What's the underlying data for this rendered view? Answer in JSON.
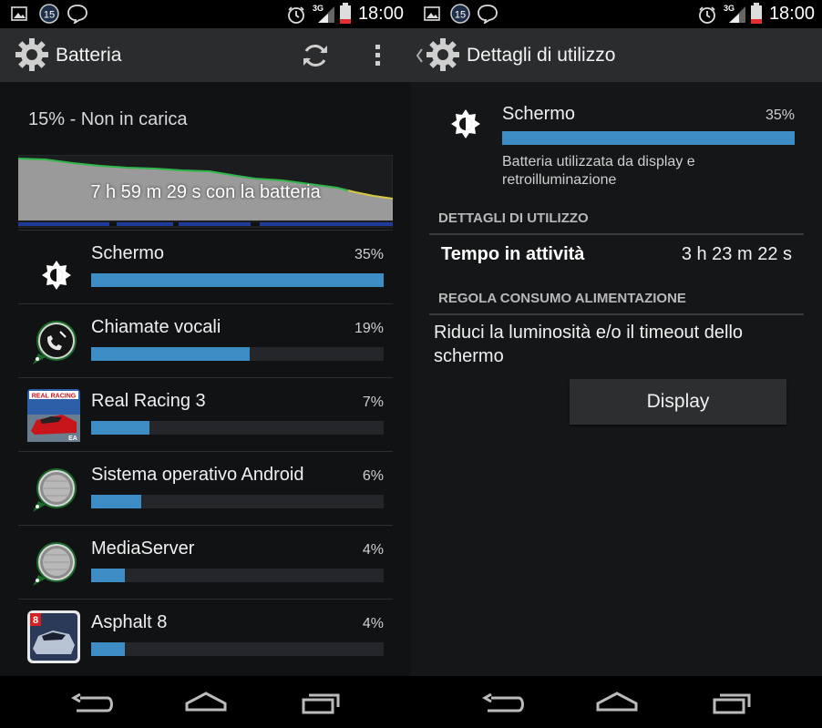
{
  "status_bar": {
    "time": "18:00",
    "notification_badge": "15",
    "network": "3G",
    "icons": [
      "image-icon",
      "badge-15-icon",
      "chat-bubble-icon",
      "alarm-icon",
      "signal-icon",
      "battery-low-icon"
    ]
  },
  "left_screen": {
    "title": "Batteria",
    "charge_status": "15% - Non in carica",
    "graph_label": "7 h 59 m 29 s con la batteria",
    "items": [
      {
        "name": "Schermo",
        "percent_label": "35%",
        "percent": 35,
        "icon": "brightness-icon"
      },
      {
        "name": "Chiamate vocali",
        "percent_label": "19%",
        "percent": 19,
        "icon": "phone-app-icon"
      },
      {
        "name": "Real Racing 3",
        "percent_label": "7%",
        "percent": 7,
        "icon": "real-racing-app-icon"
      },
      {
        "name": "Sistema operativo Android",
        "percent_label": "6%",
        "percent": 6,
        "icon": "android-system-icon"
      },
      {
        "name": "MediaServer",
        "percent_label": "4%",
        "percent": 4,
        "icon": "mediaserver-icon"
      },
      {
        "name": "Asphalt 8",
        "percent_label": "4%",
        "percent": 4,
        "icon": "asphalt-app-icon"
      }
    ],
    "app_icon_text": {
      "real_racing": "REAL RACING",
      "ea": "EA",
      "asphalt": "8"
    }
  },
  "right_screen": {
    "title": "Dettagli di utilizzo",
    "item_name": "Schermo",
    "item_percent_label": "35%",
    "item_percent": 35,
    "item_description": "Batteria utilizzata da display e retroilluminazione",
    "section_usage": "DETTAGLI DI UTILIZZO",
    "time_label": "Tempo in attività",
    "time_value": "3 h 23 m 22 s",
    "section_power": "REGOLA CONSUMO ALIMENTAZIONE",
    "hint": "Riduci la luminosità e/o il timeout dello schermo",
    "button_label": "Display"
  },
  "colors": {
    "accent_bar": "#3e8cc4",
    "graph_fill": "#9a9a9a",
    "graph_line": "#2fb84a",
    "graph_line_low": "#d8c840",
    "action_bar": "#2a2c2e"
  }
}
